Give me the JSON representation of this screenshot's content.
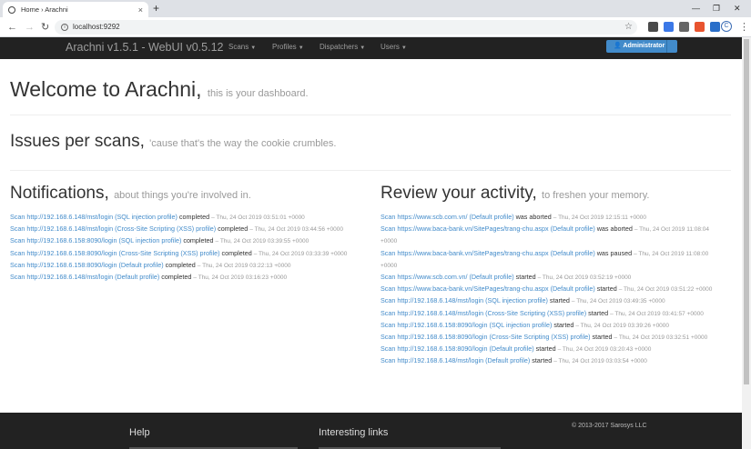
{
  "browser": {
    "tab_title": "Home › Arachni",
    "tab_close": "×",
    "new_tab": "+",
    "url": "localhost:9292",
    "profile_initial": "C"
  },
  "navbar": {
    "brand": "Arachni v1.5.1 - WebUI v0.5.12",
    "menus": [
      "Scans",
      "Profiles",
      "Dispatchers",
      "Users"
    ],
    "admin_button": "Administrator"
  },
  "welcome": {
    "title": "Welcome to Arachni,",
    "subtitle": "this is your dashboard."
  },
  "issues": {
    "title": "Issues per scans,",
    "subtitle": "'cause that's the way the cookie crumbles."
  },
  "notifications": {
    "title": "Notifications,",
    "subtitle": "about things you're involved in.",
    "items": [
      {
        "link": "Scan http://192.168.6.148/mst/login (SQL injection profile)",
        "action": "completed",
        "time": "– Thu, 24 Oct 2019 03:51:01 +0000"
      },
      {
        "link": "Scan http://192.168.6.148/mst/login (Cross-Site Scripting (XSS) profile)",
        "action": "completed",
        "time": "– Thu, 24 Oct 2019 03:44:56 +0000"
      },
      {
        "link": "Scan http://192.168.6.158:8090/login (SQL injection profile)",
        "action": "completed",
        "time": "– Thu, 24 Oct 2019 03:39:55 +0000"
      },
      {
        "link": "Scan http://192.168.6.158:8090/login (Cross-Site Scripting (XSS) profile)",
        "action": "completed",
        "time": "– Thu, 24 Oct 2019 03:33:39 +0000"
      },
      {
        "link": "Scan http://192.168.6.158:8090/login (Default profile)",
        "action": "completed",
        "time": "– Thu, 24 Oct 2019 03:22:13 +0000"
      },
      {
        "link": "Scan http://192.168.6.148/mst/login (Default profile)",
        "action": "completed",
        "time": "– Thu, 24 Oct 2019 03:16:23 +0000"
      }
    ]
  },
  "review": {
    "title": "Review your activity,",
    "subtitle": "to freshen your memory.",
    "items": [
      {
        "link": "Scan https://www.scb.com.vn/ (Default profile)",
        "action": "was aborted",
        "time": "– Thu, 24 Oct 2019 12:15:11 +0000"
      },
      {
        "link": "Scan https://www.baca-bank.vn/SitePages/trang-chu.aspx (Default profile)",
        "action": "was aborted",
        "time": "– Thu, 24 Oct 2019 11:08:04 +0000"
      },
      {
        "link": "Scan https://www.baca-bank.vn/SitePages/trang-chu.aspx (Default profile)",
        "action": "was paused",
        "time": "– Thu, 24 Oct 2019 11:08:00 +0000"
      },
      {
        "link": "Scan https://www.scb.com.vn/ (Default profile)",
        "action": "started",
        "time": "– Thu, 24 Oct 2019 03:52:19 +0000"
      },
      {
        "link": "Scan https://www.baca-bank.vn/SitePages/trang-chu.aspx (Default profile)",
        "action": "started",
        "time": "– Thu, 24 Oct 2019 03:51:22 +0000"
      },
      {
        "link": "Scan http://192.168.6.148/mst/login (SQL injection profile)",
        "action": "started",
        "time": "– Thu, 24 Oct 2019 03:49:35 +0000"
      },
      {
        "link": "Scan http://192.168.6.148/mst/login (Cross-Site Scripting (XSS) profile)",
        "action": "started",
        "time": "– Thu, 24 Oct 2019 03:41:57 +0000"
      },
      {
        "link": "Scan http://192.168.6.158:8090/login (SQL injection profile)",
        "action": "started",
        "time": "– Thu, 24 Oct 2019 03:39:26 +0000"
      },
      {
        "link": "Scan http://192.168.6.158:8090/login (Cross-Site Scripting (XSS) profile)",
        "action": "started",
        "time": "– Thu, 24 Oct 2019 03:32:51 +0000"
      },
      {
        "link": "Scan http://192.168.6.158:8090/login (Default profile)",
        "action": "started",
        "time": "– Thu, 24 Oct 2019 03:20:43 +0000"
      },
      {
        "link": "Scan http://192.168.6.148/mst/login (Default profile)",
        "action": "started",
        "time": "– Thu, 24 Oct 2019 03:03:54 +0000"
      }
    ]
  },
  "footer": {
    "help": "Help",
    "links": "Interesting links",
    "copyright": "© 2013-2017 Sarosys LLC"
  }
}
